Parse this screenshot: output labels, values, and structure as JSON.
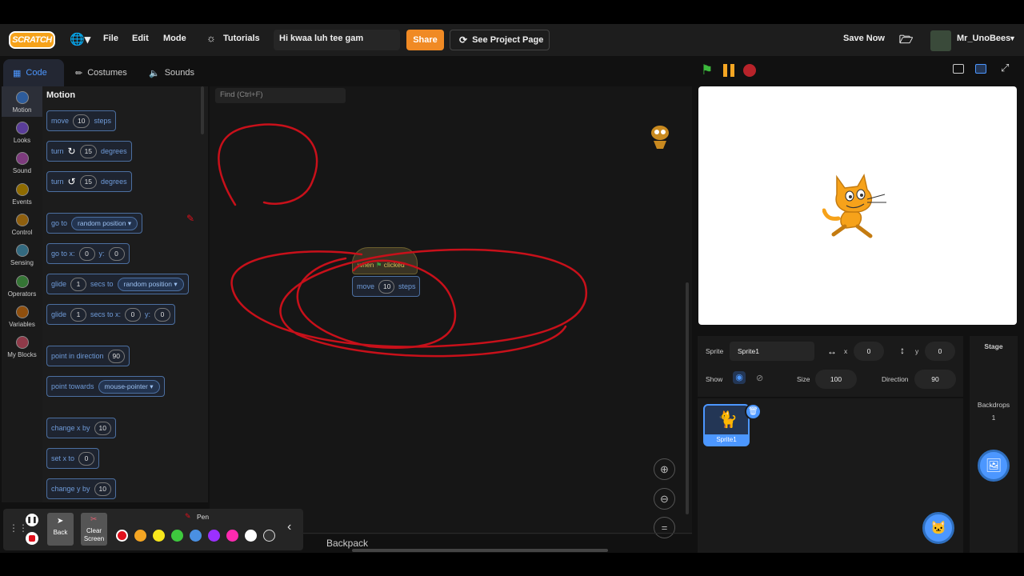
{
  "menubar": {
    "logo": "SCRATCH",
    "file": "File",
    "edit": "Edit",
    "mode": "Mode",
    "tutorials": "Tutorials",
    "project_title": "Hi kwaa luh tee gam",
    "share": "Share",
    "see_project_page": "See Project Page",
    "save_now": "Save Now",
    "username": "Mr_UnoBees"
  },
  "tabs": {
    "code": "Code",
    "costumes": "Costumes",
    "sounds": "Sounds"
  },
  "categories": [
    {
      "label": "Motion",
      "color": "#4c97ff"
    },
    {
      "label": "Looks",
      "color": "#9966ff"
    },
    {
      "label": "Sound",
      "color": "#cf63cf"
    },
    {
      "label": "Events",
      "color": "#ffbf00"
    },
    {
      "label": "Control",
      "color": "#ffab19"
    },
    {
      "label": "Sensing",
      "color": "#5cb1d6"
    },
    {
      "label": "Operators",
      "color": "#59c059"
    },
    {
      "label": "Variables",
      "color": "#ff8c1a"
    },
    {
      "label": "My Blocks",
      "color": "#ff6680"
    }
  ],
  "palette": {
    "title": "Motion",
    "move": {
      "a": "move",
      "v": "10",
      "b": "steps"
    },
    "turn_cw": {
      "a": "turn",
      "v": "15",
      "b": "degrees"
    },
    "turn_ccw": {
      "a": "turn",
      "v": "15",
      "b": "degrees"
    },
    "goto": {
      "a": "go to",
      "dd": "random position"
    },
    "goto_xy": {
      "a": "go to x:",
      "x": "0",
      "b": "y:",
      "y": "0"
    },
    "glide": {
      "a": "glide",
      "v": "1",
      "b": "secs to",
      "dd": "random position"
    },
    "glide_xy": {
      "a": "glide",
      "v": "1",
      "b": "secs to x:",
      "x": "0",
      "c": "y:",
      "y": "0"
    },
    "point_dir": {
      "a": "point in direction",
      "v": "90"
    },
    "point_towards": {
      "a": "point towards",
      "dd": "mouse-pointer"
    },
    "change_x": {
      "a": "change x by",
      "v": "10"
    },
    "set_x": {
      "a": "set x to",
      "v": "0"
    },
    "change_y": {
      "a": "change y by",
      "v": "10"
    }
  },
  "script": {
    "find_placeholder": "Find (Ctrl+F)",
    "hat_text": "when",
    "hat_text2": "clicked",
    "move": {
      "a": "move",
      "v": "10",
      "b": "steps"
    },
    "backpack": "Backpack"
  },
  "sprite_info": {
    "sprite_label": "Sprite",
    "sprite_name": "Sprite1",
    "x_label": "x",
    "x": "0",
    "y_label": "y",
    "y": "0",
    "show_label": "Show",
    "size_label": "Size",
    "size": "100",
    "direction_label": "Direction",
    "direction": "90"
  },
  "sprite_list": [
    {
      "name": "Sprite1"
    }
  ],
  "stage_panel": {
    "title": "Stage",
    "backdrops_label": "Backdrops",
    "backdrops_count": "1"
  },
  "pen_toolbar": {
    "pen_label": "Pen",
    "back": "Back",
    "clear1": "Clear",
    "clear2": "Screen",
    "colors": [
      "#e0101c",
      "#f5a623",
      "#f8e71c",
      "#3ec93e",
      "#4a90e2",
      "#9b30ff",
      "#ff2ab0",
      "#ffffff",
      "#333333"
    ]
  },
  "accent": "#4c97ff",
  "annotation_color": "#d0101c"
}
